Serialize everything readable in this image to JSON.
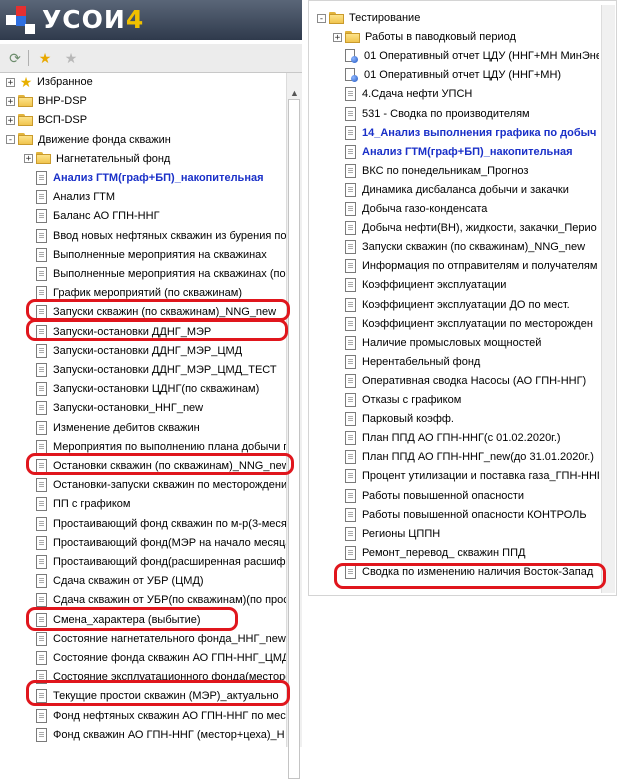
{
  "app": {
    "title": "УСОИ",
    "version": "4"
  },
  "toolbar": {
    "refresh_icon": "refresh-icon",
    "add_favorite_icon": "add-favorite-icon",
    "remove_favorite_icon": "remove-favorite-icon"
  },
  "left_tree": [
    {
      "label": "Избранное",
      "type": "star",
      "level": 0,
      "expander": "+"
    },
    {
      "label": "ВНР-DSP",
      "type": "folder",
      "level": 0,
      "expander": "+"
    },
    {
      "label": "ВСП-DSP",
      "type": "folder",
      "level": 0,
      "expander": "+"
    },
    {
      "label": "Движение фонда скважин",
      "type": "folder",
      "level": 0,
      "expander": "−"
    },
    {
      "label": "Нагнетательный фонд",
      "type": "folder",
      "level": 1,
      "expander": "+"
    },
    {
      "label": "Анализ ГТМ(граф+БП)_накопительная",
      "type": "doc",
      "level": 1,
      "style": "blue"
    },
    {
      "label": "Анализ ГТМ",
      "type": "doc",
      "level": 1
    },
    {
      "label": "Баланс АО ГПН-ННГ",
      "type": "doc",
      "level": 1
    },
    {
      "label": "Ввод новых нефтяных скважин из бурения по",
      "type": "doc",
      "level": 1
    },
    {
      "label": "Выполненные мероприятия на скважинах",
      "type": "doc",
      "level": 1
    },
    {
      "label": "Выполненные мероприятия на скважинах (по",
      "type": "doc",
      "level": 1
    },
    {
      "label": "График мероприятий (по скважинам)",
      "type": "doc",
      "level": 1
    },
    {
      "label": "Запуски скважин (по скважинам)_NNG_new",
      "type": "doc",
      "level": 1
    },
    {
      "label": "Запуски-остановки ДДНГ_МЭР",
      "type": "doc",
      "level": 1
    },
    {
      "label": "Запуски-остановки ДДНГ_МЭР_ЦМД",
      "type": "doc",
      "level": 1
    },
    {
      "label": "Запуски-остановки ДДНГ_МЭР_ЦМД_ТЕСТ",
      "type": "doc",
      "level": 1
    },
    {
      "label": "Запуски-остановки ЦДНГ(по скважинам)",
      "type": "doc",
      "level": 1
    },
    {
      "label": "Запуски-остановки_ННГ_new",
      "type": "doc",
      "level": 1
    },
    {
      "label": "Изменение дебитов скважин",
      "type": "doc",
      "level": 1
    },
    {
      "label": "Мероприятия по выполнению плана добычи по",
      "type": "doc",
      "level": 1
    },
    {
      "label": "Остановки скважин (по скважинам)_NNG_new",
      "type": "doc",
      "level": 1
    },
    {
      "label": "Остановки-запуски скважин по месторождения",
      "type": "doc",
      "level": 1
    },
    {
      "label": "ПП с графиком",
      "type": "doc",
      "level": 1
    },
    {
      "label": "Простаивающий фонд скважин по м-р(3-меся",
      "type": "doc",
      "level": 1
    },
    {
      "label": "Простаивающий фонд(МЭР на начало месяца)",
      "type": "doc",
      "level": 1
    },
    {
      "label": "Простаивающий фонд(расширенная расшифров",
      "type": "doc",
      "level": 1
    },
    {
      "label": "Сдача скважин от УБР (ЦМД)",
      "type": "doc",
      "level": 1
    },
    {
      "label": "Сдача скважин от УБР(по скважинам)(по прос",
      "type": "doc",
      "level": 1
    },
    {
      "label": "Смена_характера (выбытие)",
      "type": "doc",
      "level": 1
    },
    {
      "label": "Состояние нагнетательного фонда_ННГ_new",
      "type": "doc",
      "level": 1
    },
    {
      "label": "Состояние фонда скважин АО ГПН-ННГ_ЦМД",
      "type": "doc",
      "level": 1
    },
    {
      "label": "Состояние эксплуатационного фонда(месторож",
      "type": "doc",
      "level": 1
    },
    {
      "label": "Текущие простои скважин (МЭР)_актуально",
      "type": "doc",
      "level": 1
    },
    {
      "label": "Фонд нефтяных скважин АО ГПН-ННГ по мест",
      "type": "doc",
      "level": 1
    },
    {
      "label": "Фонд скважин АО ГПН-ННГ (местор+цеха)_Н",
      "type": "doc",
      "level": 1
    }
  ],
  "right_tree": [
    {
      "label": "Тестирование",
      "type": "folder",
      "level": 0,
      "expander": "−"
    },
    {
      "label": "Работы в паводковый период",
      "type": "folder",
      "level": 1,
      "expander": "+"
    },
    {
      "label": "01 Оперативный отчет ЦДУ (ННГ+МН МинЭне",
      "type": "docg",
      "level": 1
    },
    {
      "label": "01 Оперативный отчет ЦДУ (ННГ+МН)",
      "type": "docg",
      "level": 1
    },
    {
      "label": "4.Сдача нефти УПСН",
      "type": "doc",
      "level": 1
    },
    {
      "label": "531 - Сводка по производителям",
      "type": "doc",
      "level": 1
    },
    {
      "label": "14_Анализ выполнения графика по добыч",
      "type": "doc",
      "level": 1,
      "style": "blue"
    },
    {
      "label": "Анализ ГТМ(граф+БП)_накопительная",
      "type": "doc",
      "level": 1,
      "style": "blue"
    },
    {
      "label": "ВКС по понедельникам_Прогноз",
      "type": "doc",
      "level": 1
    },
    {
      "label": "Динамика дисбаланса добычи и закачки",
      "type": "doc",
      "level": 1
    },
    {
      "label": "Добыча газо-конденсата",
      "type": "doc",
      "level": 1
    },
    {
      "label": "Добыча нефти(ВН), жидкости, закачки_Перио",
      "type": "doc",
      "level": 1
    },
    {
      "label": "Запуски скважин (по скважинам)_NNG_new",
      "type": "doc",
      "level": 1
    },
    {
      "label": "Информация по отправителям и получателям",
      "type": "doc",
      "level": 1
    },
    {
      "label": "Коэффициент эксплуатации",
      "type": "doc",
      "level": 1
    },
    {
      "label": "Коэффициент эксплуатации ДО по мест.",
      "type": "doc",
      "level": 1
    },
    {
      "label": "Коэффициент эксплуатации по месторожден",
      "type": "doc",
      "level": 1
    },
    {
      "label": "Наличие промысловых мощностей",
      "type": "doc",
      "level": 1
    },
    {
      "label": "Нерентабельный фонд",
      "type": "doc",
      "level": 1
    },
    {
      "label": "Оперативная сводка Насосы (АО ГПН-ННГ)",
      "type": "doc",
      "level": 1
    },
    {
      "label": "Отказы с графиком",
      "type": "doc",
      "level": 1
    },
    {
      "label": "Парковый коэфф.",
      "type": "doc",
      "level": 1
    },
    {
      "label": "План ППД АО ГПН-ННГ(с 01.02.2020г.)",
      "type": "doc",
      "level": 1
    },
    {
      "label": "План ППД АО ГПН-ННГ_new(до 31.01.2020г.)",
      "type": "doc",
      "level": 1
    },
    {
      "label": "Процент утилизации и поставка газа_ГПН-ННГ",
      "type": "doc",
      "level": 1
    },
    {
      "label": "Работы повышенной опасности",
      "type": "doc",
      "level": 1
    },
    {
      "label": "Работы повышенной опасности КОНТРОЛЬ",
      "type": "doc",
      "level": 1
    },
    {
      "label": "Регионы ЦППН",
      "type": "doc",
      "level": 1
    },
    {
      "label": "Ремонт_перевод_ скважин ППД",
      "type": "doc",
      "level": 1
    },
    {
      "label": "Сводка по изменению наличия Восток-Запад",
      "type": "doc",
      "level": 1
    }
  ],
  "highlight_color": "#e0161d",
  "link_color": "#1a30c8"
}
